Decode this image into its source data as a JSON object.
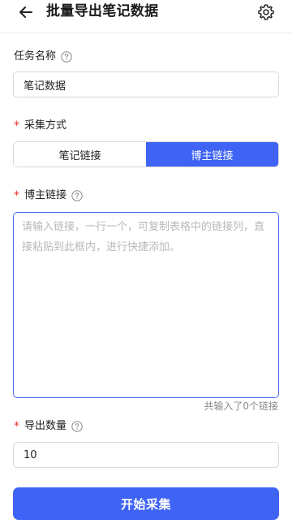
{
  "header": {
    "title": "批量导出笔记数据",
    "back_icon": "arrow-left-icon",
    "settings_icon": "gear-icon"
  },
  "task_name": {
    "label": "任务名称",
    "value": "笔记数据"
  },
  "collect_method": {
    "label": "采集方式",
    "required_mark": "*",
    "options": [
      "笔记链接",
      "博主链接"
    ],
    "selected": "博主链接"
  },
  "blogger_links": {
    "label": "博主链接",
    "required_mark": "*",
    "placeholder": "请输入链接，一行一个，可复制表格中的链接列，直接粘贴到此框内，进行快捷添加。",
    "value": "",
    "counter_text": "共输入了0个链接"
  },
  "export_count": {
    "label": "导出数量",
    "required_mark": "*",
    "value": "10"
  },
  "submit": {
    "label": "开始采集"
  },
  "colors": {
    "primary": "#3f63f4",
    "required": "#e5322d",
    "border": "#d9d9d9"
  }
}
